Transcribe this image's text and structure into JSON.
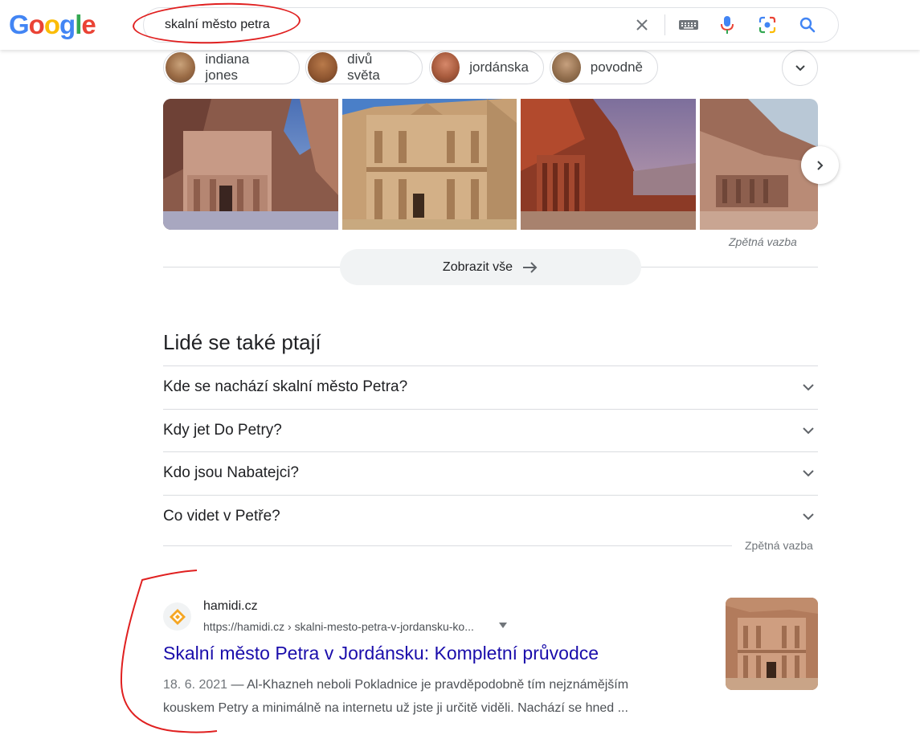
{
  "header": {
    "logo": "Google",
    "logo_letters": [
      "G",
      "o",
      "o",
      "g",
      "l",
      "e"
    ],
    "search_value": "skalní město petra"
  },
  "chips": [
    {
      "label": "indiana jones"
    },
    {
      "label": "divů světa"
    },
    {
      "label": "jordánska"
    },
    {
      "label": "povodně"
    }
  ],
  "images": {
    "feedback": "Zpětná vazba",
    "show_all": "Zobrazit vše"
  },
  "paa": {
    "title": "Lidé se také ptají",
    "questions": [
      "Kde se nachází skalní město Petra?",
      "Kdy jet Do Petry?",
      "Kdo jsou Nabatejci?",
      "Co videt v Petře?"
    ],
    "feedback": "Zpětná vazba"
  },
  "result": {
    "site_name": "hamidi.cz",
    "url": "https://hamidi.cz › skalni-mesto-petra-v-jordansku-ko...",
    "title": "Skalní město Petra v Jordánsku: Kompletní průvodce",
    "date": "18. 6. 2021",
    "snippet_line1": " — Al-Khazneh neboli Pokladnice je pravděpodobně tím nejznámějším",
    "snippet_line2": "kouskem Petry a minimálně na internetu už jste ji určitě viděli. Nachází se hned ..."
  },
  "colors": {
    "link": "#1a0dab",
    "annotation_red": "#e02020"
  }
}
